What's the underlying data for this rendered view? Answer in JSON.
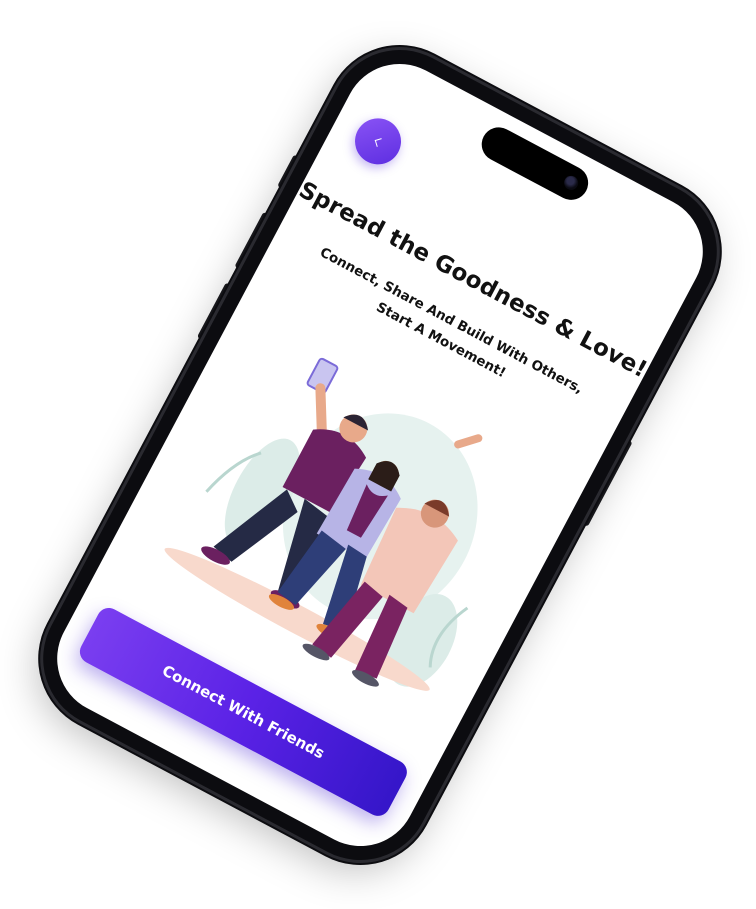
{
  "screen": {
    "title": "Spread the Goodness & Love!",
    "subtitle": "Connect, Share And Build With Others, Start A Movement!",
    "cta_label": "Connect With Friends",
    "back_icon": "chevron-left-icon",
    "illustration": "group-selfie-illustration"
  },
  "colors": {
    "accent_start": "#8c55f6",
    "accent_end": "#3516c9",
    "text": "#111111",
    "background": "#ffffff",
    "device_frame": "#0c0c10"
  }
}
